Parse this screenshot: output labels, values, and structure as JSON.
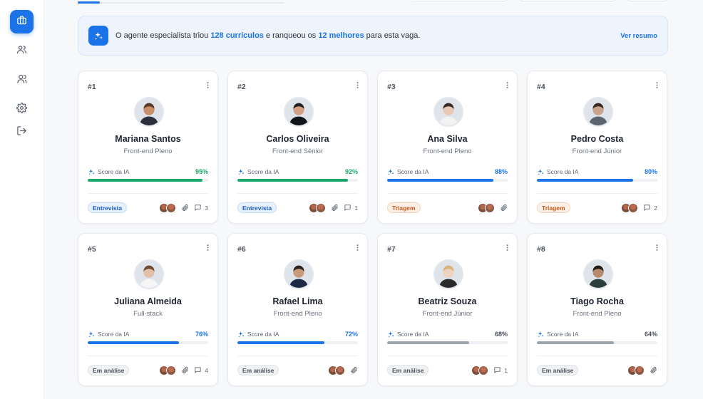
{
  "sidebar": {
    "items": [
      {
        "icon": "briefcase-icon",
        "active": true
      },
      {
        "icon": "users-icon",
        "active": false
      },
      {
        "icon": "user-group-icon",
        "active": false
      },
      {
        "icon": "gear-icon",
        "active": false
      },
      {
        "icon": "logout-icon",
        "active": false
      }
    ]
  },
  "banner": {
    "text_prefix": "O agente especialista triou ",
    "count_text": "128 currículos",
    "text_middle": " e ranqueou os ",
    "top_text": "12 melhores",
    "text_suffix": " para esta vaga.",
    "link_label": "Ver resumo"
  },
  "score_label": "Score da IA",
  "colors": {
    "accent": "#1a73e8",
    "score_high": "#1aa86a",
    "score_mid": "#1a73e8",
    "score_low": "#9ea4ae"
  },
  "candidates": [
    {
      "rank": "#1",
      "name": "Mariana Santos",
      "role": "Front-end Pleno",
      "score_text": "95%",
      "score": 95,
      "tier": "high",
      "status": "Entrevista",
      "status_type": "entrevista",
      "attachment": true,
      "comments": "3"
    },
    {
      "rank": "#2",
      "name": "Carlos Oliveira",
      "role": "Front-end Sênior",
      "score_text": "92%",
      "score": 92,
      "tier": "high",
      "status": "Entrevista",
      "status_type": "entrevista",
      "attachment": true,
      "comments": "1"
    },
    {
      "rank": "#3",
      "name": "Ana Silva",
      "role": "Front-end Pleno",
      "score_text": "88%",
      "score": 88,
      "tier": "mid",
      "status": "Triagem",
      "status_type": "triagem",
      "attachment": true,
      "comments": null
    },
    {
      "rank": "#4",
      "name": "Pedro Costa",
      "role": "Front-end Júnior",
      "score_text": "80%",
      "score": 80,
      "tier": "mid",
      "status": "Triagem",
      "status_type": "triagem",
      "attachment": false,
      "comments": "2"
    },
    {
      "rank": "#5",
      "name": "Juliana Almeida",
      "role": "Full-stack",
      "score_text": "76%",
      "score": 76,
      "tier": "mid",
      "status": "Em análise",
      "status_type": "analise",
      "attachment": true,
      "comments": "4"
    },
    {
      "rank": "#6",
      "name": "Rafael Lima",
      "role": "Front-end Pleno",
      "score_text": "72%",
      "score": 72,
      "tier": "mid",
      "status": "Em análise",
      "status_type": "analise",
      "attachment": true,
      "comments": null
    },
    {
      "rank": "#7",
      "name": "Beatriz Souza",
      "role": "Front-end Júnior",
      "score_text": "68%",
      "score": 68,
      "tier": "low",
      "status": "Em análise",
      "status_type": "analise",
      "attachment": false,
      "comments": "1"
    },
    {
      "rank": "#8",
      "name": "Tiago Rocha",
      "role": "Front-end Pleno",
      "score_text": "64%",
      "score": 64,
      "tier": "low",
      "status": "Em análise",
      "status_type": "analise",
      "attachment": true,
      "comments": null
    }
  ]
}
